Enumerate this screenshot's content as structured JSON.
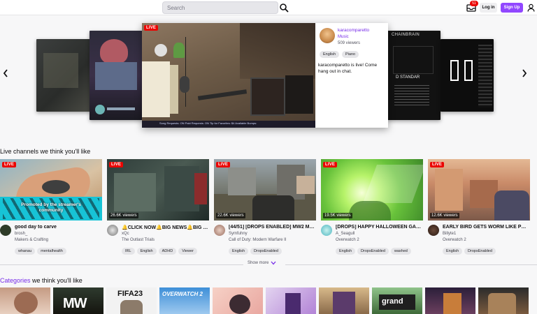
{
  "header": {
    "search_placeholder": "Search",
    "notification_count": "51",
    "login_label": "Log in",
    "signup_label": "Sign Up"
  },
  "featured": {
    "live_label": "LIVE",
    "channel_name": "karacomparetto",
    "category": "Music",
    "viewers": "509 viewers",
    "tags": [
      "English",
      "Piano"
    ],
    "description": "karacomparetto is live! Come hang out in chat.",
    "overlay_bar": "Song Requests: ON  Paid Requests: ON  Tip for Favorites: $4  Available Bumps:",
    "side_right_overlay": [
      "CHAINBRAIN",
      "D STANDAR"
    ]
  },
  "live_section": {
    "title": "Live channels we think you'll like",
    "cards": [
      {
        "live_label": "LIVE",
        "viewers": "",
        "title": "good day to carve",
        "user": "brosh_",
        "category": "Makers & Crafting",
        "tags": [
          "whanau",
          "mentalhealth"
        ],
        "promo": "Promoted by the streamer's community"
      },
      {
        "live_label": "LIVE",
        "viewers": "26.6K viewers",
        "title": "🔔CLICK NOW🔔BIG NEWS🔔BIG TO...",
        "user": "xQc",
        "category": "The Outlast Trials",
        "tags": [
          "IRL",
          "English",
          "ADHD",
          "Viewer"
        ]
      },
      {
        "live_label": "LIVE",
        "viewers": "22.6K viewers",
        "title": "[44/51] [DROPS ENABLED] MW2 MA...",
        "user": "Symfuhny",
        "category": "Call of Duty: Modern Warfare II",
        "tags": [
          "English",
          "DropsEnabled"
        ]
      },
      {
        "live_label": "LIVE",
        "viewers": "19.5K viewers",
        "title": "[DROPS] HAPPY HALLOWEEN GAMERS",
        "user": "A_Seagull",
        "category": "Overwatch 2",
        "tags": [
          "English",
          "DropsEnabled",
          "washed"
        ]
      },
      {
        "live_label": "LIVE",
        "viewers": "12.6K viewers",
        "title": "EARLY BIRD GETS WORM LIKE PROBL...",
        "user": "Billyte1",
        "category": "Overwatch 2",
        "tags": [
          "English",
          "DropsEnabled"
        ]
      }
    ],
    "show_more": "Show more"
  },
  "categories_section": {
    "title_accent": "Categories",
    "title_rest": " we think you'll like",
    "tiles": [
      {
        "label": ""
      },
      {
        "label": "MW"
      },
      {
        "label": "FIFA23"
      },
      {
        "label": "OVERWATCH 2"
      },
      {
        "label": ""
      },
      {
        "label": ""
      },
      {
        "label": ""
      },
      {
        "label": "grand"
      },
      {
        "label": ""
      },
      {
        "label": ""
      }
    ]
  },
  "colors": {
    "accent": "#9147ff",
    "accent_text": "#772ce8",
    "live_red": "#eb0400"
  }
}
